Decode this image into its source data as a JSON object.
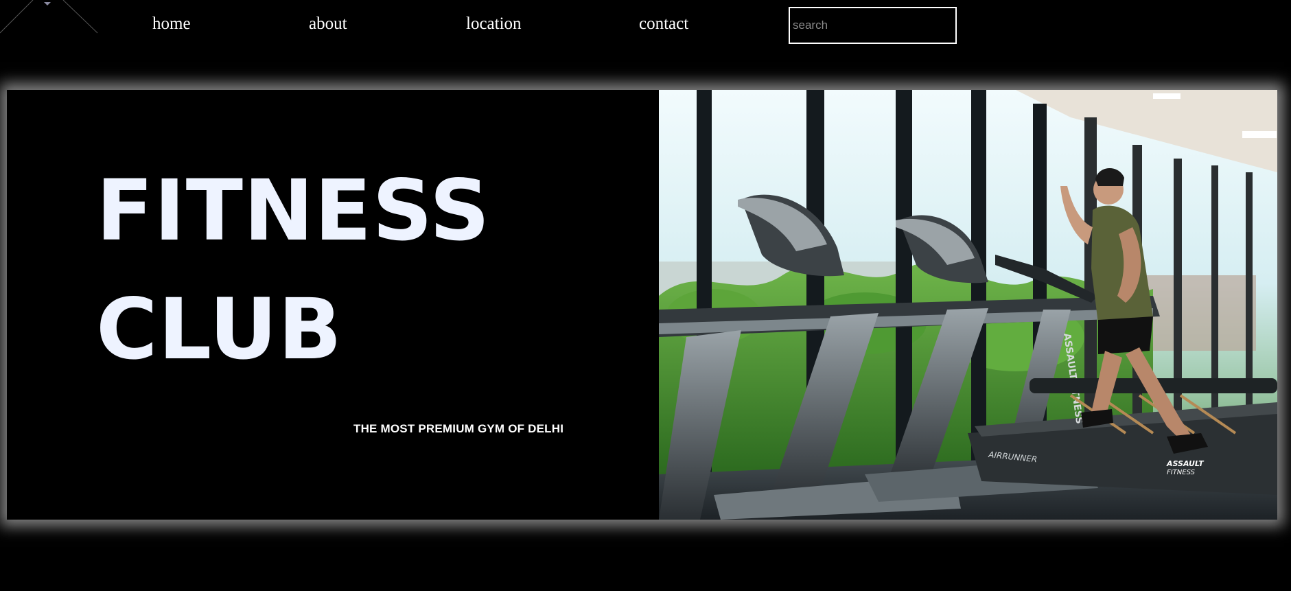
{
  "nav": {
    "home": "home",
    "about": "about",
    "location": "location",
    "contact": "contact"
  },
  "search": {
    "placeholder": "search",
    "value": ""
  },
  "hero": {
    "title_line1": "FITNESS",
    "title_line2": "CLUB",
    "tagline": "THE MOST PREMIUM GYM OF DELHI",
    "image_subject": "man running on treadmills in a gym by tall windows",
    "treadmill_brand_text": [
      "ASSAULTFITNESS",
      "AIRRUNNER",
      "ASSAULT FITNESS"
    ]
  },
  "colors": {
    "background": "#000000",
    "text": "#ffffff",
    "title": "#eef3ff",
    "glow": "#ebebeb"
  }
}
